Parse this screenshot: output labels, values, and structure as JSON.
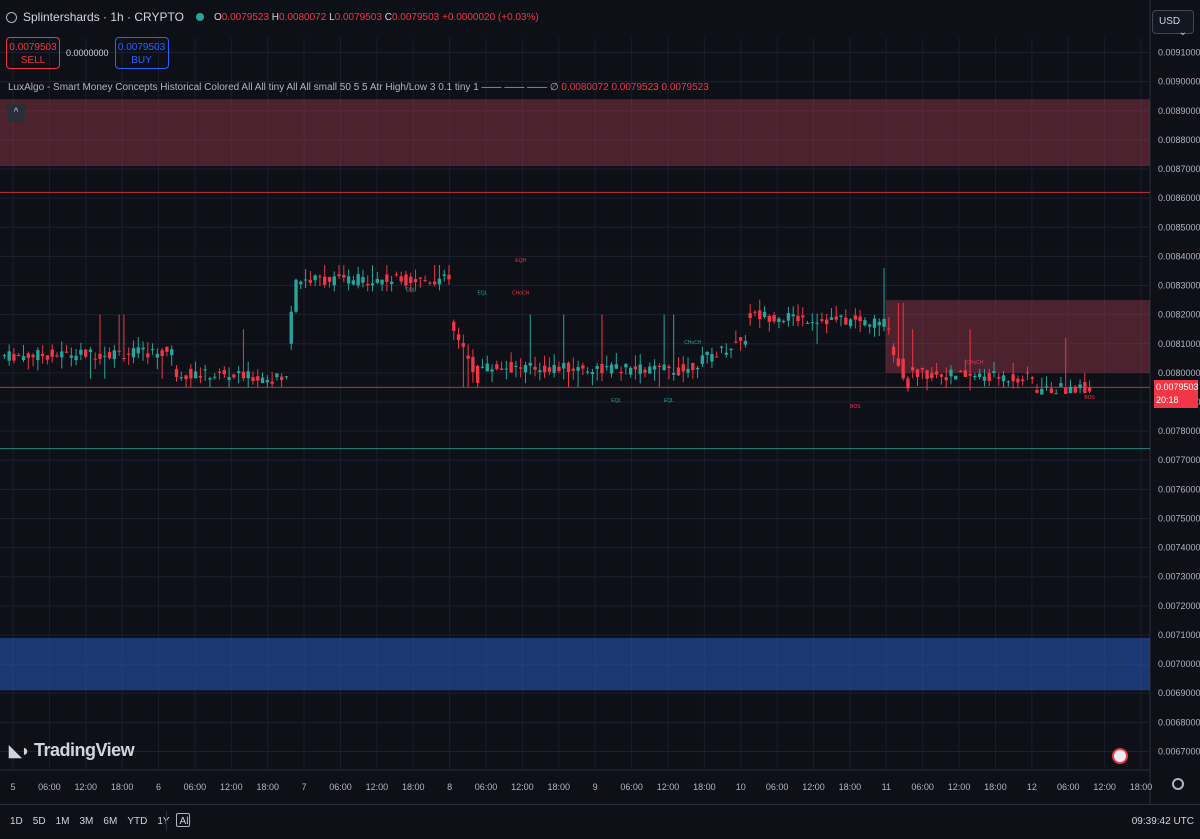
{
  "header": {
    "symbol": "Splintershards · 1h · CRYPTO",
    "o_label": "O",
    "o_value": "0.0079523",
    "h_label": "H",
    "h_value": "0.0080072",
    "l_label": "L",
    "l_value": "0.0079503",
    "c_label": "C",
    "c_value": "0.0079503",
    "change": "+0.0000020 (+0.03%)"
  },
  "trade": {
    "sell_price": "0.0079503",
    "sell_label": "SELL",
    "spread": "0.0000000",
    "buy_price": "0.0079503",
    "buy_label": "BUY"
  },
  "indicator": {
    "text": "LuxAlgo - Smart Money Concepts Historical Colored All All tiny All All small 50 5 5 Atr High/Low 3 0.1 tiny 1 —— —— ——",
    "symbol": "∅",
    "values": "0.0080072  0.0079523  0.0079523",
    "collapse_icon": "chevron-up-icon"
  },
  "currency": "USD",
  "last_price": {
    "value": "0.0079503",
    "countdown": "20:18"
  },
  "bottom": {
    "ranges": [
      "1D",
      "5D",
      "1M",
      "3M",
      "6M",
      "YTD",
      "1Y",
      "All"
    ],
    "clock": "09:39:42 UTC"
  },
  "branding": "TradingView",
  "colors": {
    "up": "#26a69a",
    "down": "#f23645",
    "bg": "#0e1018",
    "supply_zone": "#7a3a46",
    "demand_zone": "#1e3f7a"
  },
  "chart_data": {
    "type": "candlestick",
    "timeframe": "1h",
    "ylim": [
      0.00665,
      0.00915
    ],
    "y_ticks": [
      "0.0091000",
      "0.0090000",
      "0.0089000",
      "0.0088000",
      "0.0087000",
      "0.0086000",
      "0.0085000",
      "0.0084000",
      "0.0083000",
      "0.0082000",
      "0.0081000",
      "0.0080000",
      "0.0079000",
      "0.0078000",
      "0.0077000",
      "0.0076000",
      "0.0075000",
      "0.0074000",
      "0.0073000",
      "0.0072000",
      "0.0071000",
      "0.0070000",
      "0.0069000",
      "0.0068000",
      "0.0067000"
    ],
    "x_ticks": [
      "5",
      "06:00",
      "12:00",
      "18:00",
      "6",
      "06:00",
      "12:00",
      "18:00",
      "7",
      "06:00",
      "12:00",
      "18:00",
      "8",
      "06:00",
      "12:00",
      "18:00",
      "9",
      "06:00",
      "12:00",
      "18:00",
      "10",
      "06:00",
      "12:00",
      "18:00",
      "11",
      "06:00",
      "12:00",
      "18:00",
      "12",
      "06:00",
      "12:00",
      "18:00"
    ],
    "segments": [
      {
        "start": 0.008058,
        "end": 0.008072,
        "bars": 36,
        "hi": 0.0082,
        "lo": 0.00798
      },
      {
        "start": 0.008,
        "end": 0.00798,
        "bars": 24,
        "hi": 0.00815,
        "lo": 0.00795
      },
      {
        "start": 0.0081,
        "end": 0.00832,
        "bars": 2,
        "hi": 0.00835,
        "lo": 0.00797
      },
      {
        "start": 0.00832,
        "end": 0.00832,
        "bars": 32,
        "hi": 0.00837,
        "lo": 0.00828
      },
      {
        "start": 0.00817,
        "end": 0.00798,
        "bars": 6,
        "hi": 0.00825,
        "lo": 0.00795
      },
      {
        "start": 0.00802,
        "end": 0.00801,
        "bars": 44,
        "hi": 0.0082,
        "lo": 0.00795
      },
      {
        "start": 0.00802,
        "end": 0.00812,
        "bars": 12,
        "hi": 0.00824,
        "lo": 0.00798
      },
      {
        "start": 0.0082,
        "end": 0.00817,
        "bars": 30,
        "hi": 0.00836,
        "lo": 0.0081
      },
      {
        "start": 0.0081,
        "end": 0.00796,
        "bars": 4,
        "hi": 0.00824,
        "lo": 0.00791
      },
      {
        "start": 0.008,
        "end": 0.00798,
        "bars": 26,
        "hi": 0.00815,
        "lo": 0.00794
      },
      {
        "start": 0.00794,
        "end": 0.0079503,
        "bars": 12,
        "hi": 0.00812,
        "lo": 0.00793
      }
    ],
    "zones": [
      {
        "kind": "supply",
        "top": 0.00894,
        "bottom": 0.00871,
        "x_from": 0.0,
        "x_to": 1.0
      },
      {
        "kind": "supply",
        "top": 0.00825,
        "bottom": 0.008,
        "x_from": 0.77,
        "x_to": 1.0
      },
      {
        "kind": "demand",
        "top": 0.00709,
        "bottom": 0.00691,
        "x_from": 0.0,
        "x_to": 1.0
      }
    ],
    "levels": [
      {
        "price": 0.00862,
        "color": "#f23645"
      },
      {
        "price": 0.0079503,
        "color": "#f23645"
      },
      {
        "price": 0.00774,
        "color": "#26a69a"
      }
    ],
    "labels": [
      {
        "text": "EQL",
        "price": 0.00828,
        "bar": 85,
        "color": "#26a69a"
      },
      {
        "text": "EQH",
        "price": 0.00838,
        "bar": 108,
        "color": "#f23645"
      },
      {
        "text": "EQL",
        "price": 0.00827,
        "bar": 100,
        "color": "#26a69a"
      },
      {
        "text": "CHoCH",
        "price": 0.00827,
        "bar": 108,
        "color": "#f23645"
      },
      {
        "text": "EQL",
        "price": 0.0079,
        "bar": 128,
        "color": "#26a69a"
      },
      {
        "text": "EQL",
        "price": 0.0079,
        "bar": 139,
        "color": "#26a69a"
      },
      {
        "text": "CHoCH",
        "price": 0.0081,
        "bar": 144,
        "color": "#26a69a"
      },
      {
        "text": "BOS",
        "price": 0.00788,
        "bar": 178,
        "color": "#f23645"
      },
      {
        "text": "CHoCH",
        "price": 0.00803,
        "bar": 203,
        "color": "#f23645"
      },
      {
        "text": "BOS",
        "price": 0.00791,
        "bar": 227,
        "color": "#f23645"
      }
    ]
  }
}
